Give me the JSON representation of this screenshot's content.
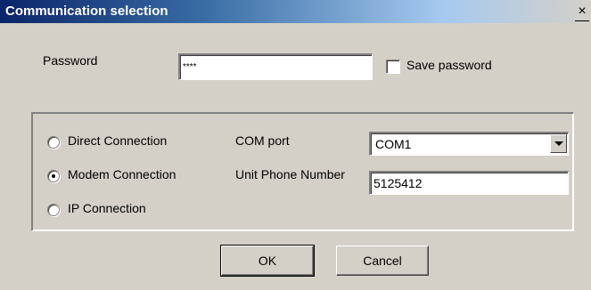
{
  "window": {
    "title": "Communication selection",
    "close_glyph": "×"
  },
  "password": {
    "label": "Password",
    "value": "****",
    "save_label": "Save password",
    "save_checked": false
  },
  "connection": {
    "options": [
      {
        "label": "Direct Connection",
        "selected": false
      },
      {
        "label": "Modem Connection",
        "selected": true
      },
      {
        "label": "IP Connection",
        "selected": false
      }
    ],
    "com_port_label": "COM port",
    "com_port_value": "COM1",
    "phone_label": "Unit Phone Number",
    "phone_value": "5125412"
  },
  "buttons": {
    "ok": "OK",
    "cancel": "Cancel"
  },
  "colors": {
    "title_bg": "#0a246a",
    "face": "#d4d0c8"
  }
}
